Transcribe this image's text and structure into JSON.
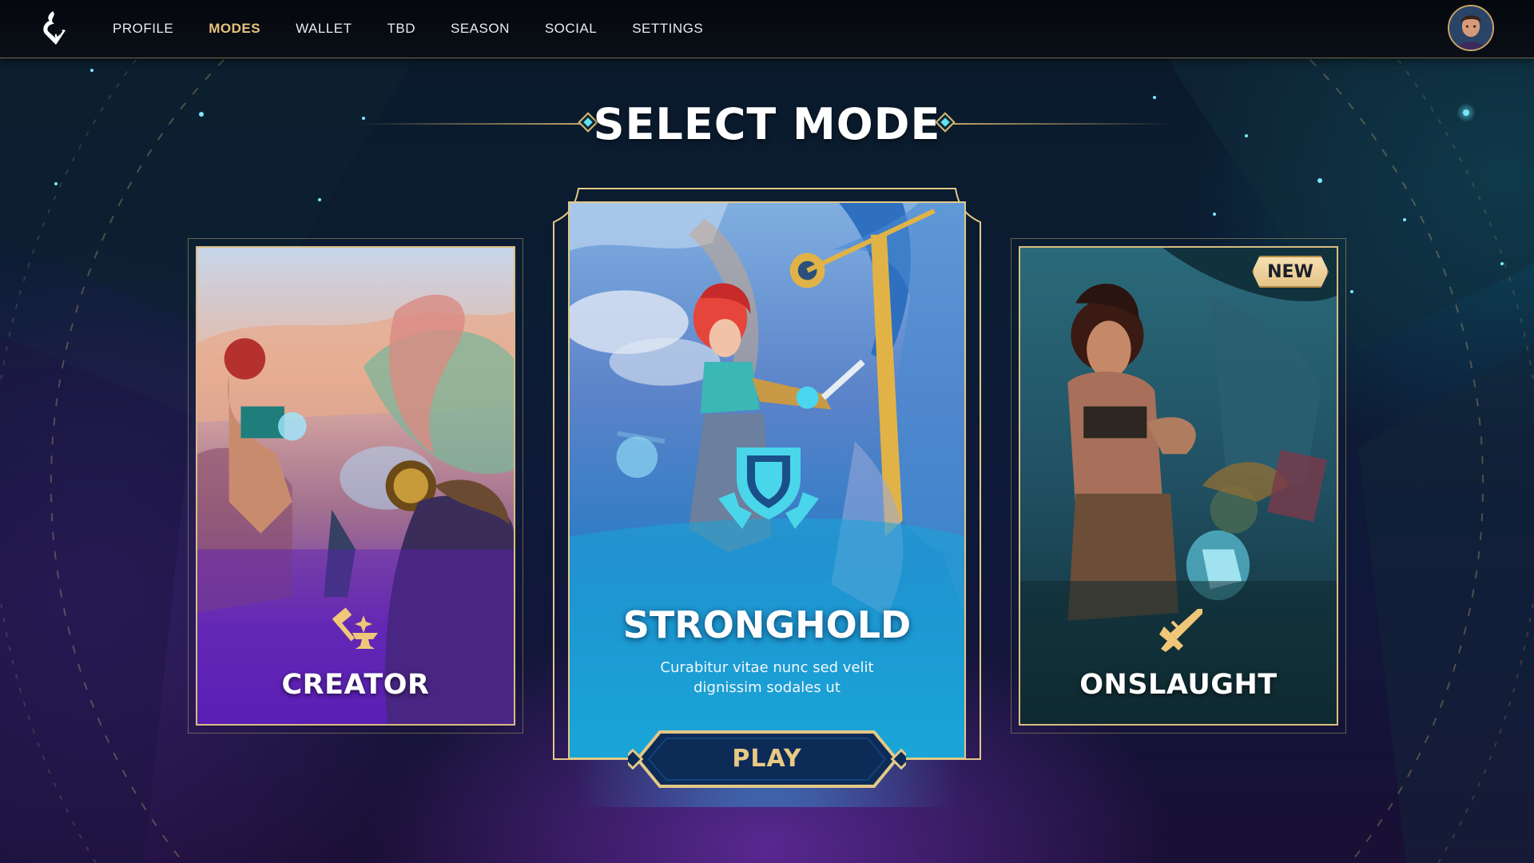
{
  "nav": {
    "items": [
      {
        "label": "PROFILE",
        "active": false
      },
      {
        "label": "MODES",
        "active": true
      },
      {
        "label": "WALLET",
        "active": false
      },
      {
        "label": "TBD",
        "active": false
      },
      {
        "label": "SEASON",
        "active": false
      },
      {
        "label": "SOCIAL",
        "active": false
      },
      {
        "label": "SETTINGS",
        "active": false
      }
    ],
    "logo_icon": "flame-logo-icon",
    "avatar": "user-avatar"
  },
  "header": {
    "title": "SELECT MODE"
  },
  "modes": {
    "creator": {
      "label": "CREATOR",
      "icon": "hammer-anvil-icon"
    },
    "stronghold": {
      "label": "STRONGHOLD",
      "description": "Curabitur vitae nunc sed velit dignissim sodales ut",
      "icon": "shield-icon",
      "play_label": "PLAY",
      "selected": true
    },
    "onslaught": {
      "label": "ONSLAUGHT",
      "icon": "crossed-swords-icon",
      "badge": "NEW"
    }
  },
  "colors": {
    "accent_gold": "#e7c27e",
    "frame_gold": "#d9bd82",
    "cyan": "#5fe4ef",
    "creator_purple": "#5a23b0",
    "stronghold_blue": "#1f8fd6",
    "onslaught_teal": "#173c44"
  }
}
